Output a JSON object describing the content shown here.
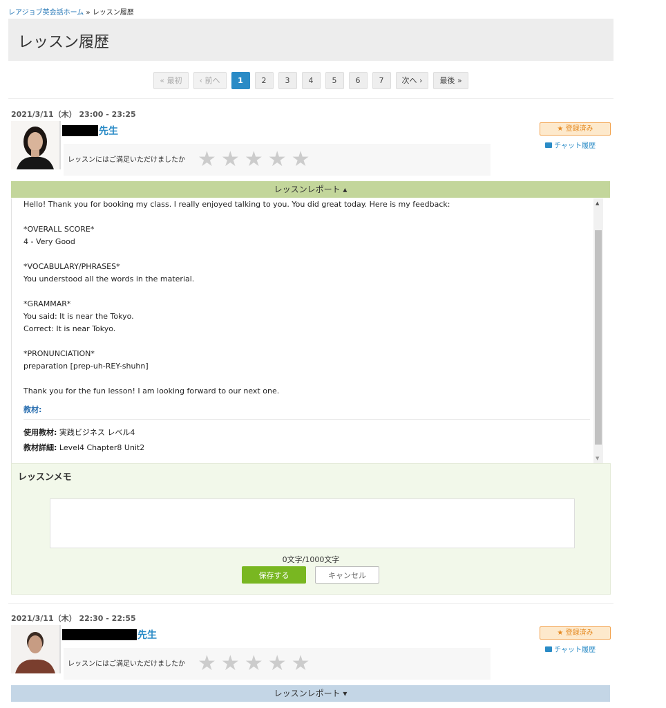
{
  "breadcrumb": {
    "home": "レアジョブ英会話ホーム",
    "sep": "»",
    "current": "レッスン履歴"
  },
  "page_title": "レッスン履歴",
  "pagination": {
    "first": "« 最初",
    "prev": "‹ 前へ",
    "pages": [
      "1",
      "2",
      "3",
      "4",
      "5",
      "6",
      "7"
    ],
    "next": "次へ ›",
    "last": "最後 »",
    "current": "1"
  },
  "lessons": [
    {
      "date": "2021/3/11（木） 23:00 - 23:25",
      "teacher_suffix": "先生",
      "rating_question": "レッスンにはご満足いただけましたか",
      "stars": [
        "★",
        "★",
        "★",
        "★",
        "★"
      ],
      "badge": "★ 登録済み",
      "chat": "チャット履歴",
      "report_toggle": "レッスンレポート ▴",
      "report_text": "Hello! Thank you for booking my class. I really enjoyed talking to you. You did great today. Here is my feedback:\n\n*OVERALL SCORE*\n4 - Very Good\n\n*VOCABULARY/PHRASES*\nYou understood all the words in the material.\n\n*GRAMMAR*\nYou said: It is near the Tokyo.\nCorrect: It is near Tokyo.\n\n*PRONUNCIATION*\npreparation [prep-uh-REY-shuhn]\n\nThank you for the fun lesson! I am looking forward to our next one.",
      "materials_heading": "教材:",
      "material_label": "使用教材:",
      "material_value": "実践ビジネス レベル4",
      "detail_label": "教材詳細:",
      "detail_value": "Level4 Chapter8 Unit2",
      "memo_title": "レッスンメモ",
      "memo_counter": "0文字/1000文字",
      "save_label": "保存する",
      "cancel_label": "キャンセル"
    },
    {
      "date": "2021/3/11（木） 22:30 - 22:55",
      "teacher_suffix": "先生",
      "rating_question": "レッスンにはご満足いただけましたか",
      "stars": [
        "★",
        "★",
        "★",
        "★",
        "★"
      ],
      "badge": "★ 登録済み",
      "chat": "チャット履歴",
      "report_toggle": "レッスンレポート ▾"
    }
  ],
  "colors": {
    "accent": "#2a8bc6",
    "report_open": "#c3d69b",
    "report_closed": "#c4d6e6",
    "save": "#79b721",
    "badge": "#e58a22"
  }
}
